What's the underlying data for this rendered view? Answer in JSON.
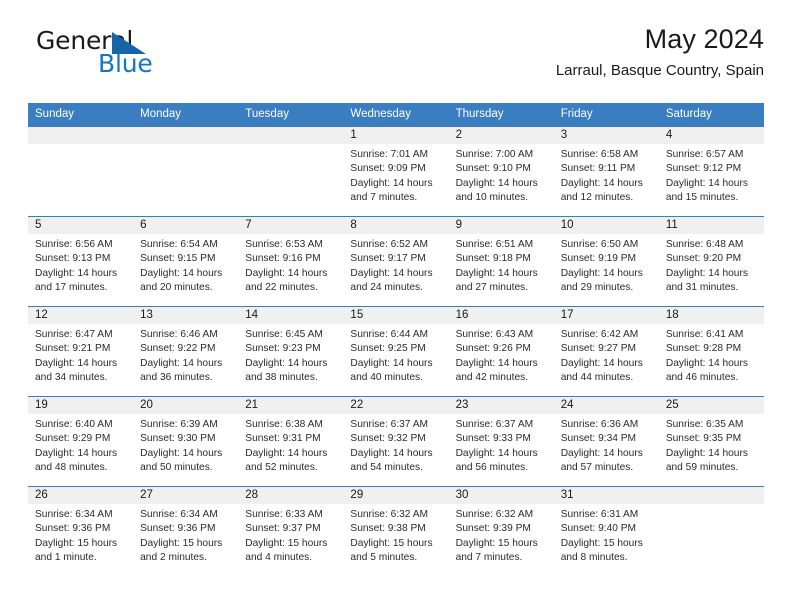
{
  "brand": {
    "name_part1": "General",
    "name_part2": "Blue",
    "triangle_color": "#1565a8",
    "blue_color": "#1277c4"
  },
  "header": {
    "title": "May 2024",
    "subtitle": "Larraul, Basque Country, Spain"
  },
  "theme": {
    "header_blue": "#3a7dc0",
    "daynum_band": "#f0f0f0",
    "text": "#1a1a1a"
  },
  "weekday_headers": [
    "Sunday",
    "Monday",
    "Tuesday",
    "Wednesday",
    "Thursday",
    "Friday",
    "Saturday"
  ],
  "weeks": [
    [
      {
        "day": "",
        "blank": true
      },
      {
        "day": "",
        "blank": true
      },
      {
        "day": "",
        "blank": true
      },
      {
        "day": "1",
        "sunrise": "Sunrise: 7:01 AM",
        "sunset": "Sunset: 9:09 PM",
        "daylight1": "Daylight: 14 hours",
        "daylight2": "and 7 minutes."
      },
      {
        "day": "2",
        "sunrise": "Sunrise: 7:00 AM",
        "sunset": "Sunset: 9:10 PM",
        "daylight1": "Daylight: 14 hours",
        "daylight2": "and 10 minutes."
      },
      {
        "day": "3",
        "sunrise": "Sunrise: 6:58 AM",
        "sunset": "Sunset: 9:11 PM",
        "daylight1": "Daylight: 14 hours",
        "daylight2": "and 12 minutes."
      },
      {
        "day": "4",
        "sunrise": "Sunrise: 6:57 AM",
        "sunset": "Sunset: 9:12 PM",
        "daylight1": "Daylight: 14 hours",
        "daylight2": "and 15 minutes."
      }
    ],
    [
      {
        "day": "5",
        "sunrise": "Sunrise: 6:56 AM",
        "sunset": "Sunset: 9:13 PM",
        "daylight1": "Daylight: 14 hours",
        "daylight2": "and 17 minutes."
      },
      {
        "day": "6",
        "sunrise": "Sunrise: 6:54 AM",
        "sunset": "Sunset: 9:15 PM",
        "daylight1": "Daylight: 14 hours",
        "daylight2": "and 20 minutes."
      },
      {
        "day": "7",
        "sunrise": "Sunrise: 6:53 AM",
        "sunset": "Sunset: 9:16 PM",
        "daylight1": "Daylight: 14 hours",
        "daylight2": "and 22 minutes."
      },
      {
        "day": "8",
        "sunrise": "Sunrise: 6:52 AM",
        "sunset": "Sunset: 9:17 PM",
        "daylight1": "Daylight: 14 hours",
        "daylight2": "and 24 minutes."
      },
      {
        "day": "9",
        "sunrise": "Sunrise: 6:51 AM",
        "sunset": "Sunset: 9:18 PM",
        "daylight1": "Daylight: 14 hours",
        "daylight2": "and 27 minutes."
      },
      {
        "day": "10",
        "sunrise": "Sunrise: 6:50 AM",
        "sunset": "Sunset: 9:19 PM",
        "daylight1": "Daylight: 14 hours",
        "daylight2": "and 29 minutes."
      },
      {
        "day": "11",
        "sunrise": "Sunrise: 6:48 AM",
        "sunset": "Sunset: 9:20 PM",
        "daylight1": "Daylight: 14 hours",
        "daylight2": "and 31 minutes."
      }
    ],
    [
      {
        "day": "12",
        "sunrise": "Sunrise: 6:47 AM",
        "sunset": "Sunset: 9:21 PM",
        "daylight1": "Daylight: 14 hours",
        "daylight2": "and 34 minutes."
      },
      {
        "day": "13",
        "sunrise": "Sunrise: 6:46 AM",
        "sunset": "Sunset: 9:22 PM",
        "daylight1": "Daylight: 14 hours",
        "daylight2": "and 36 minutes."
      },
      {
        "day": "14",
        "sunrise": "Sunrise: 6:45 AM",
        "sunset": "Sunset: 9:23 PM",
        "daylight1": "Daylight: 14 hours",
        "daylight2": "and 38 minutes."
      },
      {
        "day": "15",
        "sunrise": "Sunrise: 6:44 AM",
        "sunset": "Sunset: 9:25 PM",
        "daylight1": "Daylight: 14 hours",
        "daylight2": "and 40 minutes."
      },
      {
        "day": "16",
        "sunrise": "Sunrise: 6:43 AM",
        "sunset": "Sunset: 9:26 PM",
        "daylight1": "Daylight: 14 hours",
        "daylight2": "and 42 minutes."
      },
      {
        "day": "17",
        "sunrise": "Sunrise: 6:42 AM",
        "sunset": "Sunset: 9:27 PM",
        "daylight1": "Daylight: 14 hours",
        "daylight2": "and 44 minutes."
      },
      {
        "day": "18",
        "sunrise": "Sunrise: 6:41 AM",
        "sunset": "Sunset: 9:28 PM",
        "daylight1": "Daylight: 14 hours",
        "daylight2": "and 46 minutes."
      }
    ],
    [
      {
        "day": "19",
        "sunrise": "Sunrise: 6:40 AM",
        "sunset": "Sunset: 9:29 PM",
        "daylight1": "Daylight: 14 hours",
        "daylight2": "and 48 minutes."
      },
      {
        "day": "20",
        "sunrise": "Sunrise: 6:39 AM",
        "sunset": "Sunset: 9:30 PM",
        "daylight1": "Daylight: 14 hours",
        "daylight2": "and 50 minutes."
      },
      {
        "day": "21",
        "sunrise": "Sunrise: 6:38 AM",
        "sunset": "Sunset: 9:31 PM",
        "daylight1": "Daylight: 14 hours",
        "daylight2": "and 52 minutes."
      },
      {
        "day": "22",
        "sunrise": "Sunrise: 6:37 AM",
        "sunset": "Sunset: 9:32 PM",
        "daylight1": "Daylight: 14 hours",
        "daylight2": "and 54 minutes."
      },
      {
        "day": "23",
        "sunrise": "Sunrise: 6:37 AM",
        "sunset": "Sunset: 9:33 PM",
        "daylight1": "Daylight: 14 hours",
        "daylight2": "and 56 minutes."
      },
      {
        "day": "24",
        "sunrise": "Sunrise: 6:36 AM",
        "sunset": "Sunset: 9:34 PM",
        "daylight1": "Daylight: 14 hours",
        "daylight2": "and 57 minutes."
      },
      {
        "day": "25",
        "sunrise": "Sunrise: 6:35 AM",
        "sunset": "Sunset: 9:35 PM",
        "daylight1": "Daylight: 14 hours",
        "daylight2": "and 59 minutes."
      }
    ],
    [
      {
        "day": "26",
        "sunrise": "Sunrise: 6:34 AM",
        "sunset": "Sunset: 9:36 PM",
        "daylight1": "Daylight: 15 hours",
        "daylight2": "and 1 minute."
      },
      {
        "day": "27",
        "sunrise": "Sunrise: 6:34 AM",
        "sunset": "Sunset: 9:36 PM",
        "daylight1": "Daylight: 15 hours",
        "daylight2": "and 2 minutes."
      },
      {
        "day": "28",
        "sunrise": "Sunrise: 6:33 AM",
        "sunset": "Sunset: 9:37 PM",
        "daylight1": "Daylight: 15 hours",
        "daylight2": "and 4 minutes."
      },
      {
        "day": "29",
        "sunrise": "Sunrise: 6:32 AM",
        "sunset": "Sunset: 9:38 PM",
        "daylight1": "Daylight: 15 hours",
        "daylight2": "and 5 minutes."
      },
      {
        "day": "30",
        "sunrise": "Sunrise: 6:32 AM",
        "sunset": "Sunset: 9:39 PM",
        "daylight1": "Daylight: 15 hours",
        "daylight2": "and 7 minutes."
      },
      {
        "day": "31",
        "sunrise": "Sunrise: 6:31 AM",
        "sunset": "Sunset: 9:40 PM",
        "daylight1": "Daylight: 15 hours",
        "daylight2": "and 8 minutes."
      },
      {
        "day": "",
        "blank": true
      }
    ]
  ]
}
